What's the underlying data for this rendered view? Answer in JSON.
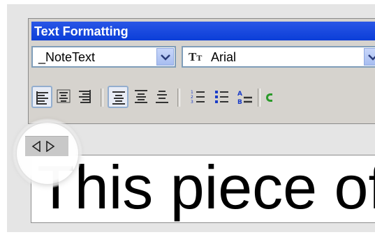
{
  "toolbar": {
    "title": "Text Formatting",
    "style_value": "_NoteText",
    "font_value": "Arial"
  },
  "text_box": {
    "content": "This piece of"
  },
  "colors": {
    "titlebar": "#0b3ed8",
    "toolbar_bg": "#d6d3ce",
    "accent_green": "#2a9a2a"
  },
  "icons": [
    "align-left-icon",
    "align-center-icon",
    "align-right-icon",
    "align-top-icon",
    "align-middle-icon",
    "align-bottom-icon",
    "numbered-list-icon",
    "bulleted-list-icon",
    "lettered-list-icon",
    "truetype-font-icon",
    "indent-arrows-icon"
  ]
}
